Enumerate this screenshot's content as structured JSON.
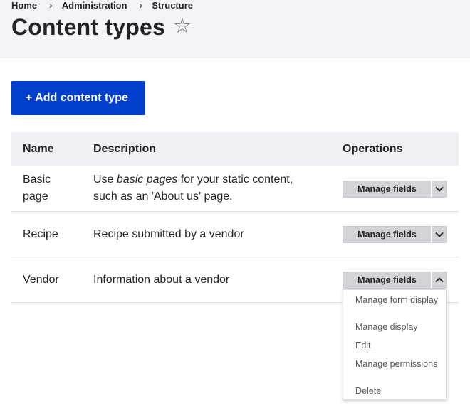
{
  "breadcrumb": {
    "items": [
      "Home",
      "Administration",
      "Structure"
    ],
    "separator": "›"
  },
  "page": {
    "title": "Content types",
    "favorite_icon": "star-outline-icon"
  },
  "actions": {
    "add_label": "+ Add content type",
    "accent_color": "#003ecc"
  },
  "table": {
    "headers": {
      "name": "Name",
      "description": "Description",
      "operations": "Operations"
    },
    "rows": [
      {
        "name": "Basic page",
        "description_pre": "Use ",
        "description_em": "basic pages",
        "description_post": " for your static content, such as an 'About us' page.",
        "operation": "Manage fields",
        "expanded": false
      },
      {
        "name": "Recipe",
        "description": "Recipe submitted by a vendor",
        "operation": "Manage fields",
        "expanded": false
      },
      {
        "name": "Vendor",
        "description": "Information about a vendor",
        "operation": "Manage fields",
        "expanded": true
      }
    ]
  },
  "dropdown": {
    "items": [
      "Manage form display",
      "Manage display",
      "Edit",
      "Manage permissions",
      "Delete"
    ]
  }
}
